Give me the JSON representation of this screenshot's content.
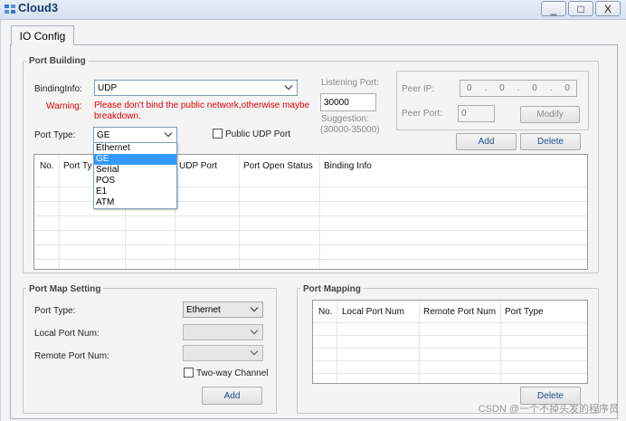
{
  "window": {
    "title": "Cloud3",
    "minimize_label": "_",
    "maximize_label": "□",
    "close_label": "X"
  },
  "tabs": [
    {
      "label": "IO Config",
      "selected": true
    }
  ],
  "port_building": {
    "title": "Port Building",
    "binding_info_label": "BindingInfo:",
    "binding_info_value": "UDP",
    "warning_label": "Warning:",
    "warning_text": "Please don't bind the public network,otherwise maybe breakdown.",
    "listening_port_label": "Listening Port:",
    "listening_port_value": "30000",
    "suggestion_label": "Suggestion:",
    "suggestion_range": "(30000-35000)",
    "peer_ip_label": "Peer IP:",
    "peer_ip_octets": [
      "0",
      "0",
      "0",
      "0"
    ],
    "peer_port_label": "Peer Port:",
    "peer_port_value": "0",
    "modify_label": "Modify",
    "port_type_label": "Port Type:",
    "port_type_value": "GE",
    "public_udp_label": "Public UDP Port",
    "add_label": "Add",
    "delete_label": "Delete",
    "table_headers": [
      "No.",
      "Port Ty",
      "UDP Port",
      "Port Open Status",
      "Binding Info"
    ],
    "dropdown_options": [
      "Ethernet",
      "GE",
      "Serial",
      "POS",
      "E1",
      "ATM"
    ],
    "dropdown_selected": "GE"
  },
  "port_map_setting": {
    "title": "Port Map Setting",
    "port_type_label": "Port Type:",
    "port_type_value": "Ethernet",
    "local_port_label": "Local Port Num:",
    "remote_port_label": "Remote Port Num:",
    "two_way_label": "Two-way Channel",
    "add_label": "Add"
  },
  "port_mapping": {
    "title": "Port Mapping",
    "table_headers": [
      "No.",
      "Local Port Num",
      "Remote Port Num",
      "Port Type"
    ],
    "delete_label": "Delete"
  },
  "watermark": "CSDN @一个不掉头发的程序员",
  "icons": [
    "cloud-app-icon",
    "chevron-down-icon"
  ]
}
